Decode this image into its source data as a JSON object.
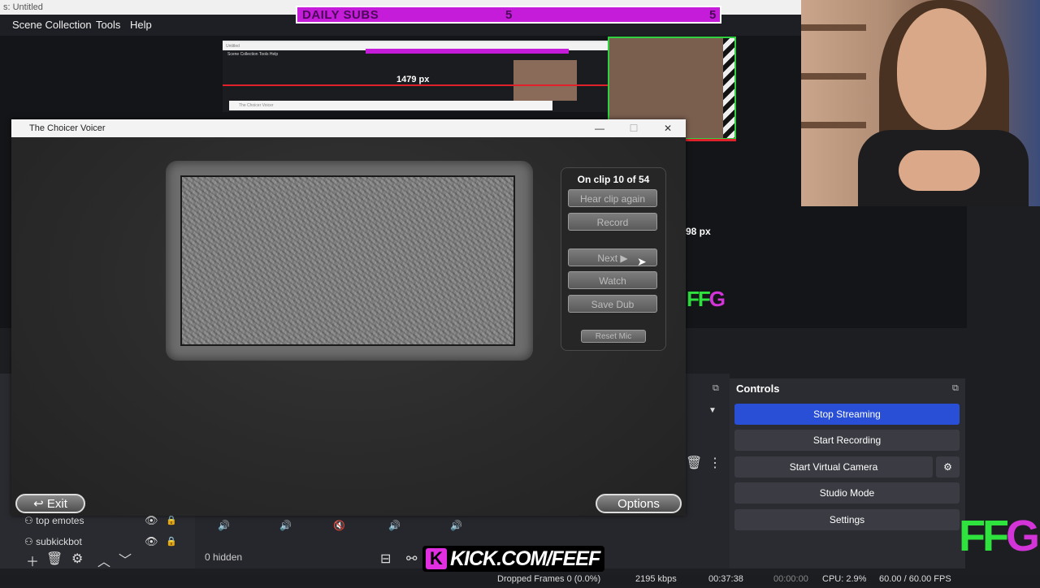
{
  "obs": {
    "title": "s: Untitled",
    "menu": [
      "Scene Collection",
      "Tools",
      "Help"
    ]
  },
  "preview": {
    "daily_subs_label": "DAILY SUBS",
    "daily_subs_count_1": "5",
    "daily_subs_count_2": "5",
    "mini_title": "Untitled",
    "mini_menu": "Scene Collection   Tools   Help",
    "mini_px": "1479 px",
    "mini_window_title": "The Choicer Voicer",
    "px_label": "98 px",
    "ffg_green": "FF",
    "ffg_pink": "G"
  },
  "choicer": {
    "title": "The Choicer Voicer",
    "clip_counter": "On clip 10 of 54",
    "buttons": {
      "hear_again": "Hear clip again",
      "record": "Record",
      "next": "Next ▶",
      "watch": "Watch",
      "save_dub": "Save Dub",
      "reset_mic": "Reset Mic"
    },
    "exit": "↩ Exit",
    "options": "Options"
  },
  "sources": [
    {
      "name": "top emotes"
    },
    {
      "name": "subkickbot"
    }
  ],
  "mixer": {
    "hidden": "0 hidden"
  },
  "controls": {
    "title": "Controls",
    "stop_streaming": "Stop Streaming",
    "start_recording": "Start Recording",
    "start_virtual_camera": "Start Virtual Camera",
    "studio_mode": "Studio Mode",
    "settings": "Settings"
  },
  "status": {
    "dropped": "Dropped Frames 0 (0.0%)",
    "kbps": "2195 kbps",
    "stream_time": "00:37:38",
    "rec_time": "00:00:00",
    "cpu": "CPU: 2.9%",
    "fps": "60.00 / 60.00 FPS"
  },
  "overlay": {
    "kick_logo": "K",
    "kick_text": "KICK.COM/FEEF",
    "ffg_green": "FF",
    "ffg_pink": "G"
  },
  "colors": {
    "accent_blue": "#284fd6",
    "magenta": "#c41cd8",
    "green": "#2fe33f"
  }
}
